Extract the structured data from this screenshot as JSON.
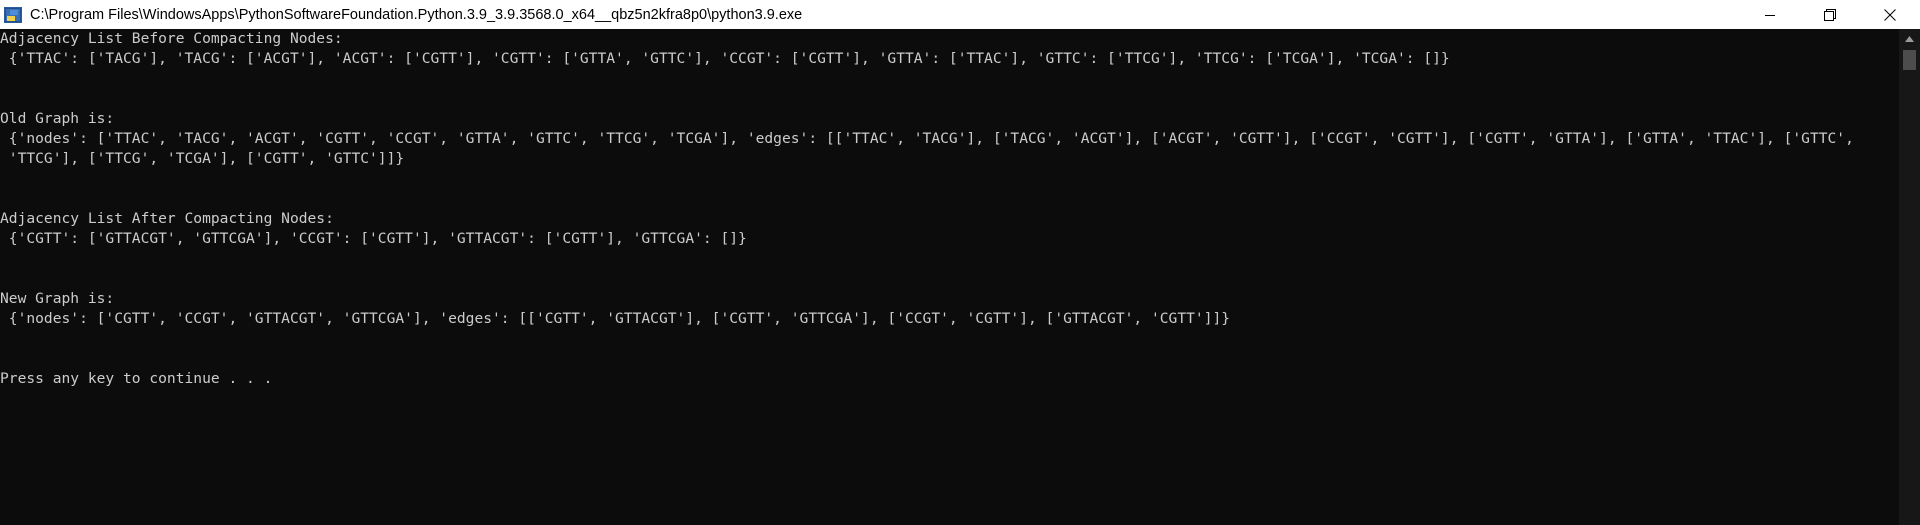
{
  "window": {
    "title": "C:\\Program Files\\WindowsApps\\PythonSoftwareFoundation.Python.3.9_3.9.3568.0_x64__qbz5n2kfra8p0\\python3.9.exe",
    "icon": "python-console-icon",
    "controls": {
      "minimize": "minimize-icon",
      "maximize": "restore-icon",
      "close": "close-icon"
    }
  },
  "console": {
    "lines": [
      "Adjacency List Before Compacting Nodes:",
      " {'TTAC': ['TACG'], 'TACG': ['ACGT'], 'ACGT': ['CGTT'], 'CGTT': ['GTTA', 'GTTC'], 'CCGT': ['CGTT'], 'GTTA': ['TTAC'], 'GTTC': ['TTCG'], 'TTCG': ['TCGA'], 'TCGA': []}",
      "",
      "",
      "Old Graph is:",
      " {'nodes': ['TTAC', 'TACG', 'ACGT', 'CGTT', 'CCGT', 'GTTA', 'GTTC', 'TTCG', 'TCGA'], 'edges': [['TTAC', 'TACG'], ['TACG', 'ACGT'], ['ACGT', 'CGTT'], ['CCGT', 'CGTT'], ['CGTT', 'GTTA'], ['GTTA', 'TTAC'], ['GTTC',",
      " 'TTCG'], ['TTCG', 'TCGA'], ['CGTT', 'GTTC']]}",
      "",
      "",
      "Adjacency List After Compacting Nodes:",
      " {'CGTT': ['GTTACGT', 'GTTCGA'], 'CCGT': ['CGTT'], 'GTTACGT': ['CGTT'], 'GTTCGA': []}",
      "",
      "",
      "New Graph is:",
      " {'nodes': ['CGTT', 'CCGT', 'GTTACGT', 'GTTCGA'], 'edges': [['CGTT', 'GTTACGT'], ['CGTT', 'GTTCGA'], ['CCGT', 'CGTT'], ['GTTACGT', 'CGTT']]}",
      "",
      "",
      "Press any key to continue . . ."
    ]
  },
  "colors": {
    "console_bg": "#0c0c0c",
    "console_text": "#cccccc",
    "titlebar_bg": "#ffffff"
  }
}
